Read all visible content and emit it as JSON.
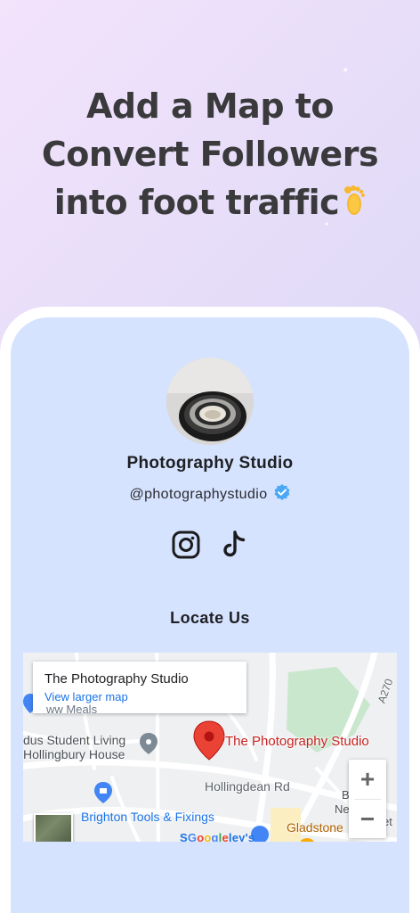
{
  "headline": {
    "line1": "Add a Map to",
    "line2": "Convert Followers",
    "line3": "into foot traffic"
  },
  "profile": {
    "name": "Photography Studio",
    "handle": "@photographystudio",
    "verified": true,
    "socials": [
      "instagram-icon",
      "tiktok-icon"
    ]
  },
  "section": {
    "title": "Locate Us"
  },
  "map": {
    "card_title": "The Photography Studio",
    "card_link": "View larger map",
    "place_name": "The Photography Studio",
    "labels": {
      "student_living_1": "dus Student Living",
      "student_living_2": "Hollingbury House",
      "road": "Hollingdean Rd",
      "tools": "Brighton Tools & Fixings",
      "gladstone": "Gladstone",
      "road_code": "A270",
      "partial_top": "ww Meals",
      "partial_sgoodaley": "S",
      "partial_b": "B",
      "partial_ne": "Ne",
      "partial_et": "et"
    },
    "zoom_in": "+",
    "zoom_out": "−",
    "google_letters": [
      "G",
      "o",
      "o",
      "g",
      "l",
      "e"
    ],
    "google_tail": "ley's"
  },
  "colors": {
    "screen_bg": "#d6e3ff",
    "verified": "#4aa8f5",
    "pin": "#ea4335",
    "link": "#1a73e8"
  }
}
